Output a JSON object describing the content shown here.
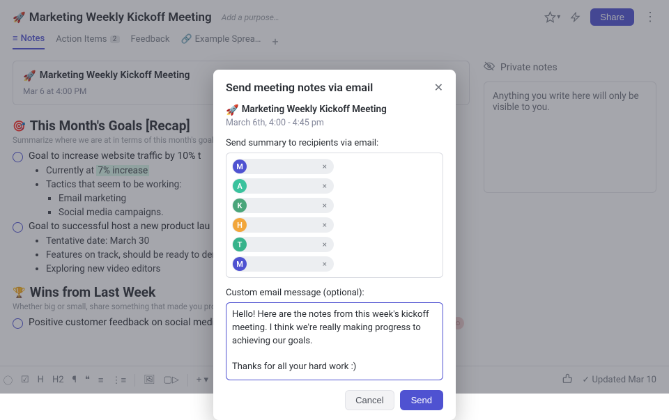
{
  "header": {
    "emoji": "🚀",
    "title": "Marketing Weekly Kickoff Meeting",
    "purpose_placeholder": "Add a purpose…",
    "share_label": "Share"
  },
  "tabs": {
    "notes": "Notes",
    "action_items": "Action Items",
    "action_count": "2",
    "feedback": "Feedback",
    "example": "Example Sprea…"
  },
  "doc_header": {
    "emoji": "🚀",
    "title": "Marketing Weekly Kickoff Meeting",
    "time": "Mar 6 at 4:00 PM"
  },
  "section_goals": {
    "emoji": "🎯",
    "title": "This Month's Goals [Recap]",
    "subtitle": "Summarize where we are at in terms of this month's goals/ta",
    "task1": "Goal to increase website traffic by 10% t",
    "bullets1": {
      "a": "Currently at ",
      "a_hl": "7% increase",
      "b": "Tactics that seem to be working:",
      "b1": "Email marketing",
      "b2": "Social media campaigns."
    },
    "task2": "Goal to successful host a new product lau",
    "bullets2": {
      "a": "Tentative date: March 30",
      "b": "Features on track, should be ready to den",
      "c": "Exploring new video editors"
    }
  },
  "section_wins": {
    "emoji": "🏆",
    "title": "Wins from Last Week",
    "subtitle": "Whether big or small, share something that made you proud last week!",
    "task1": "Positive customer feedback on social media!"
  },
  "footer": {
    "tools": {
      "circle": "⃝",
      "check": "☑",
      "h": "H",
      "h2": "H2",
      "para": "¶",
      "quote": "❝",
      "olist": "≡",
      "ulist": "⋮≡",
      "image": "🖼",
      "video": "▢▷",
      "plus": "+ ▾"
    },
    "thumbs": "👍",
    "updated_prefix": "✓ Updated ",
    "updated_value": "Mar 10"
  },
  "private": {
    "eye_icon": "🚫👁",
    "title": "Private notes",
    "body": "Anything you write here will only be visible to you."
  },
  "modal": {
    "title": "Send meeting notes via email",
    "sub_emoji": "🚀",
    "sub_title": "Marketing Weekly Kickoff Meeting",
    "sub_time": "March 6th, 4:00 - 4:45 pm",
    "recipients_label": "Send summary to recipients via email:",
    "recipients": [
      {
        "letter": "M",
        "color": "c-blue"
      },
      {
        "letter": "A",
        "color": "c-green"
      },
      {
        "letter": "K",
        "color": "c-dgreen"
      },
      {
        "letter": "H",
        "color": "c-orange"
      },
      {
        "letter": "T",
        "color": "c-teal"
      },
      {
        "letter": "M",
        "color": "c-blue"
      }
    ],
    "message_label": "Custom email message (optional):",
    "message": "Hello! Here are the notes from this week's kickoff meeting. I think we're really making progress to achieving our goals.\n\nThanks for all your hard work :)",
    "cancel": "Cancel",
    "send": "Send"
  }
}
